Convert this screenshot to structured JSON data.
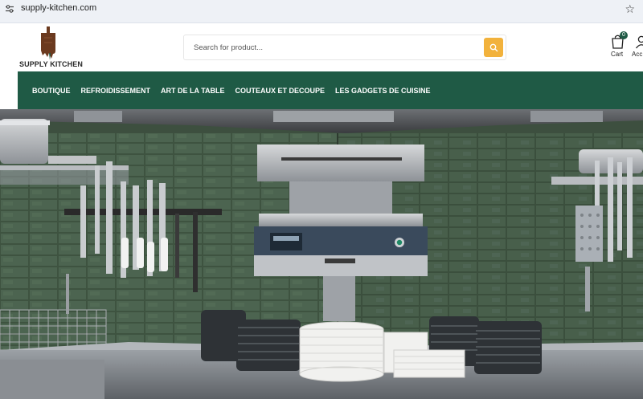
{
  "browser": {
    "url": "supply-kitchen.com",
    "tune_icon": "tune-icon",
    "bookmark_icon": "star-icon"
  },
  "header": {
    "logo_text": "SUPPLY KITCHEN",
    "search": {
      "placeholder": "Search for product..."
    },
    "cart": {
      "label": "Cart",
      "count": "0"
    },
    "account": {
      "label": "Acc"
    }
  },
  "nav": {
    "items": [
      {
        "label": "BOUTIQUE"
      },
      {
        "label": "REFROIDISSEMENT"
      },
      {
        "label": "ART DE LA TABLE"
      },
      {
        "label": "COUTEAUX ET DECOUPE"
      },
      {
        "label": "LES GADGETS DE CUISINE"
      }
    ]
  },
  "colors": {
    "brand_green": "#1f5a45",
    "search_button": "#f2b23c",
    "logo_brown": "#6b3a1f"
  },
  "hero": {
    "alt": "Professional kitchen with salamander grill, knives and stacked plates"
  }
}
